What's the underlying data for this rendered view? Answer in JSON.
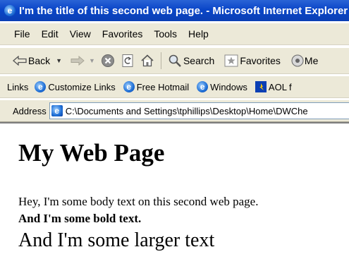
{
  "window": {
    "title": "I'm the title of this second web page. - Microsoft Internet Explorer"
  },
  "menu": [
    "File",
    "Edit",
    "View",
    "Favorites",
    "Tools",
    "Help"
  ],
  "toolbar": {
    "back": "Back",
    "search": "Search",
    "favorites": "Favorites",
    "media_partial": "Me"
  },
  "links": {
    "label": "Links",
    "items": [
      "Customize Links",
      "Free Hotmail",
      "Windows",
      "AOL f"
    ]
  },
  "address": {
    "label": "Address",
    "url": "C:\\Documents and Settings\\tphillips\\Desktop\\Home\\DWChe"
  },
  "page": {
    "heading": "My Web Page",
    "body_text": "Hey, I'm some body text on this second web page.",
    "bold_text": "And I'm some bold text.",
    "larger_text": "And I'm some larger text"
  }
}
